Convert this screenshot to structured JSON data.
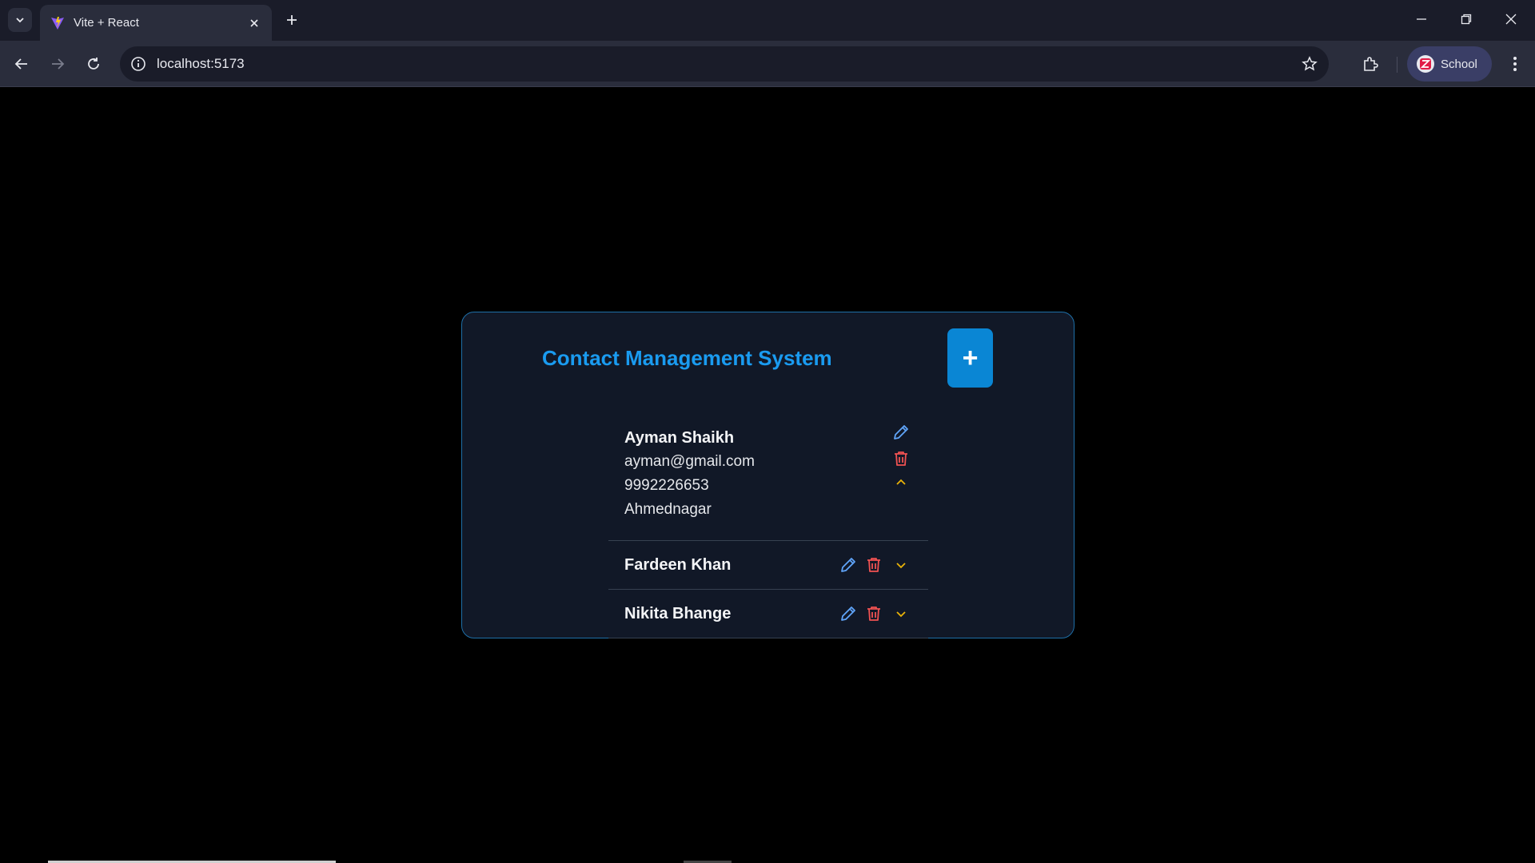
{
  "browser": {
    "tab_title": "Vite + React",
    "url": "localhost:5173",
    "profile_label": "School"
  },
  "app": {
    "title": "Contact Management System",
    "add_label": "+",
    "contacts": [
      {
        "name": "Ayman Shaikh",
        "email": "ayman@gmail.com",
        "phone": "9992226653",
        "city": "Ahmednagar",
        "expanded": true
      },
      {
        "name": "Fardeen Khan",
        "expanded": false
      },
      {
        "name": "Nikita Bhange",
        "expanded": false
      }
    ]
  },
  "colors": {
    "accent": "#1a9bf0",
    "edit": "#60a5fa",
    "delete": "#f05252",
    "toggle": "#eab308",
    "card_bg": "#111827"
  }
}
